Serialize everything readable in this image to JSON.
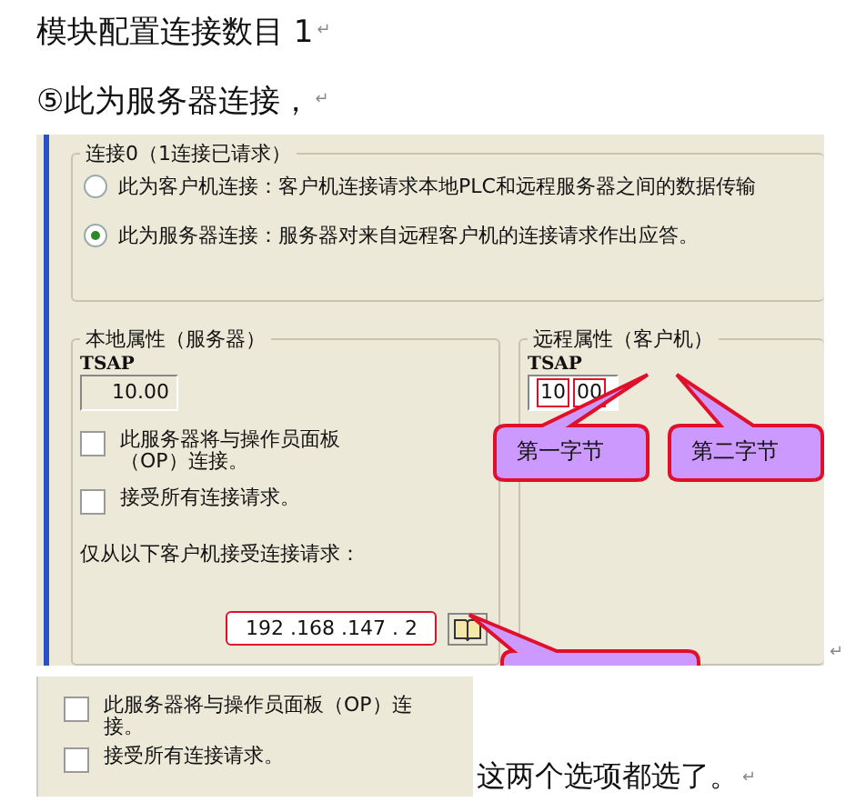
{
  "paragraphs": [
    {
      "text": "模块配置连接数目  1",
      "mark": "↵"
    },
    {
      "text": "⑤此为服务器连接，",
      "mark": "↵"
    }
  ],
  "dialog": {
    "group_title": "连接0（1连接已请求）",
    "options": [
      {
        "label": "此为客户机连接：客户机连接请求本地PLC和远程服务器之间的数据传输",
        "selected": false
      },
      {
        "label": "此为服务器连接：服务器对来自远程客户机的连接请求作出应答。",
        "selected": true
      }
    ],
    "local": {
      "title": "本地属性（服务器）",
      "tsap_label": "TSAP",
      "tsap": "10.00",
      "checkboxes": [
        {
          "label": "此服务器将与操作员面板（OP）连接。",
          "checked": false
        },
        {
          "label": "接受所有连接请求。",
          "checked": false
        }
      ],
      "accept_label": "仅从以下客户机接受连接请求：",
      "ip": "192 .168 .147 . 2"
    },
    "remote": {
      "title": "远程属性（客户机）",
      "tsap_label": "TSAP",
      "tsap_bytes": [
        "10",
        "00"
      ]
    },
    "callouts": [
      "第一字节",
      "第二字节"
    ],
    "mark": "↵"
  },
  "excerpt": {
    "checkboxes": [
      {
        "label": "此服务器将与操作员面板（OP）连接。",
        "checked": false
      },
      {
        "label": "接受所有连接请求。",
        "checked": false
      }
    ]
  },
  "caption": {
    "text": "这两个选项都选了。",
    "mark": "↵"
  }
}
